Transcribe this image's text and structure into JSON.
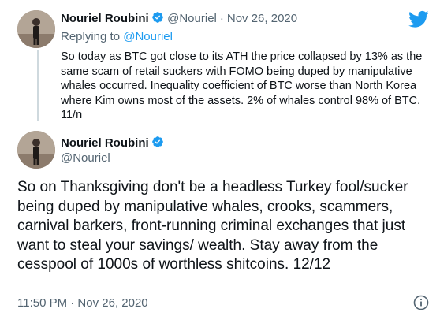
{
  "tweet1": {
    "author_name": "Nouriel Roubini",
    "author_handle": "@Nouriel",
    "separator": "·",
    "date": "Nov 26, 2020",
    "replying_prefix": "Replying to",
    "replying_to": "@Nouriel",
    "text": "So today as BTC got close to its ATH the price collapsed by 13% as the same scam of retail suckers with FOMO being duped by manipulative whales occurred. Inequality coefficient of BTC worse than North Korea where Kim owns most of the assets. 2% of whales control 98% of BTC. 11/n"
  },
  "tweet2": {
    "author_name": "Nouriel Roubini",
    "author_handle": "@Nouriel",
    "text": "So on Thanksgiving don't be a headless Turkey fool/sucker being duped by manipulative whales, crooks, scammers, carnival barkers, front-running criminal exchanges that just want to steal your savings/ wealth. Stay away from the cesspool of 1000s of worthless shitcoins. 12/12",
    "timestamp": "11:50 PM · Nov 26, 2020"
  },
  "icons": {
    "verified": "verified-badge-icon",
    "brand": "twitter-bird-icon",
    "info": "info-icon"
  },
  "colors": {
    "brand_blue": "#1d9bf0",
    "secondary_text": "#536471",
    "thread_line": "#cfd9de"
  }
}
